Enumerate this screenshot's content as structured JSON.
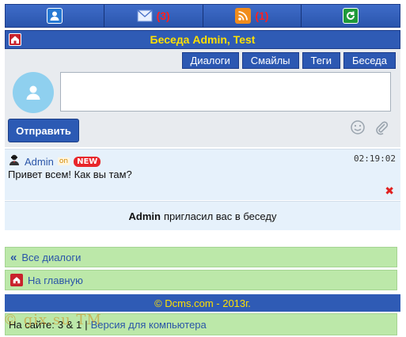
{
  "topnav": {
    "messages_count": "(3)",
    "feed_count": "(1)"
  },
  "conversation": {
    "title": "Беседа Admin, Test"
  },
  "tabs": [
    "Диалоги",
    "Смайлы",
    "Теги",
    "Беседа"
  ],
  "composer": {
    "placeholder": "",
    "send_label": "Отправить"
  },
  "post": {
    "author": "Admin",
    "status": "on",
    "badge": "NEW",
    "time": "02:19:02",
    "text": "Привет всем! Как вы там?"
  },
  "invite": {
    "user": "Admin",
    "text": "пригласил вас в беседу"
  },
  "links": {
    "all_dialogs": "Все диалоги",
    "home": "На главную"
  },
  "footer": {
    "copyright": "© Dcms.com - 2013г."
  },
  "bottom": {
    "online_label": "На сайте:",
    "online_value": "3 & 1",
    "separator": "|",
    "version_link": "Версия для компьютера",
    "watermark": "© gix.su TM"
  },
  "colors": {
    "nav_blue": "#2f5bb5",
    "title_yellow": "#ffe000",
    "link_green_bg": "#bce8a9",
    "badge_red": "#e8262a"
  }
}
